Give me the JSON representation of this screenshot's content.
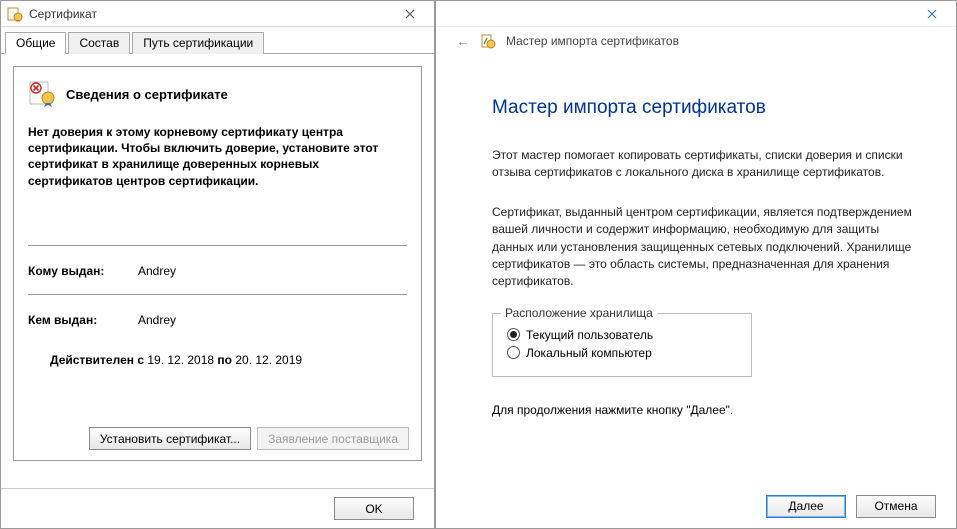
{
  "cert_window": {
    "title": "Сертификат",
    "tabs": [
      "Общие",
      "Состав",
      "Путь сертификации"
    ],
    "header": "Сведения о сертификате",
    "warning": "Нет доверия к этому корневому сертификату центра сертификации. Чтобы включить доверие, установите этот сертификат в хранилище доверенных корневых сертификатов центров сертификации.",
    "issued_to_label": "Кому выдан:",
    "issued_to_value": "Andrey",
    "issued_by_label": "Кем выдан:",
    "issued_by_value": "Andrey",
    "valid_prefix": "Действителен с",
    "valid_from": "19. 12. 2018",
    "valid_mid": "по",
    "valid_to": "20. 12. 2019",
    "install_btn": "Установить сертификат...",
    "statement_btn": "Заявление поставщика",
    "ok_btn": "OK"
  },
  "wizard": {
    "breadcrumb": "Мастер импорта сертификатов",
    "heading": "Мастер импорта сертификатов",
    "para1": "Этот мастер помогает копировать сертификаты, списки доверия и списки отзыва сертификатов с локального диска в хранилище сертификатов.",
    "para2": "Сертификат, выданный центром сертификации, является подтверждением вашей личности и содержит информацию, необходимую для защиты данных или установления защищенных сетевых подключений. Хранилище сертификатов — это область системы, предназначенная для хранения сертификатов.",
    "group_label": "Расположение хранилища",
    "radio1": "Текущий пользователь",
    "radio2": "Локальный компьютер",
    "hint": "Для продолжения нажмите кнопку \"Далее\".",
    "next_btn": "Далее",
    "cancel_btn": "Отмена"
  }
}
